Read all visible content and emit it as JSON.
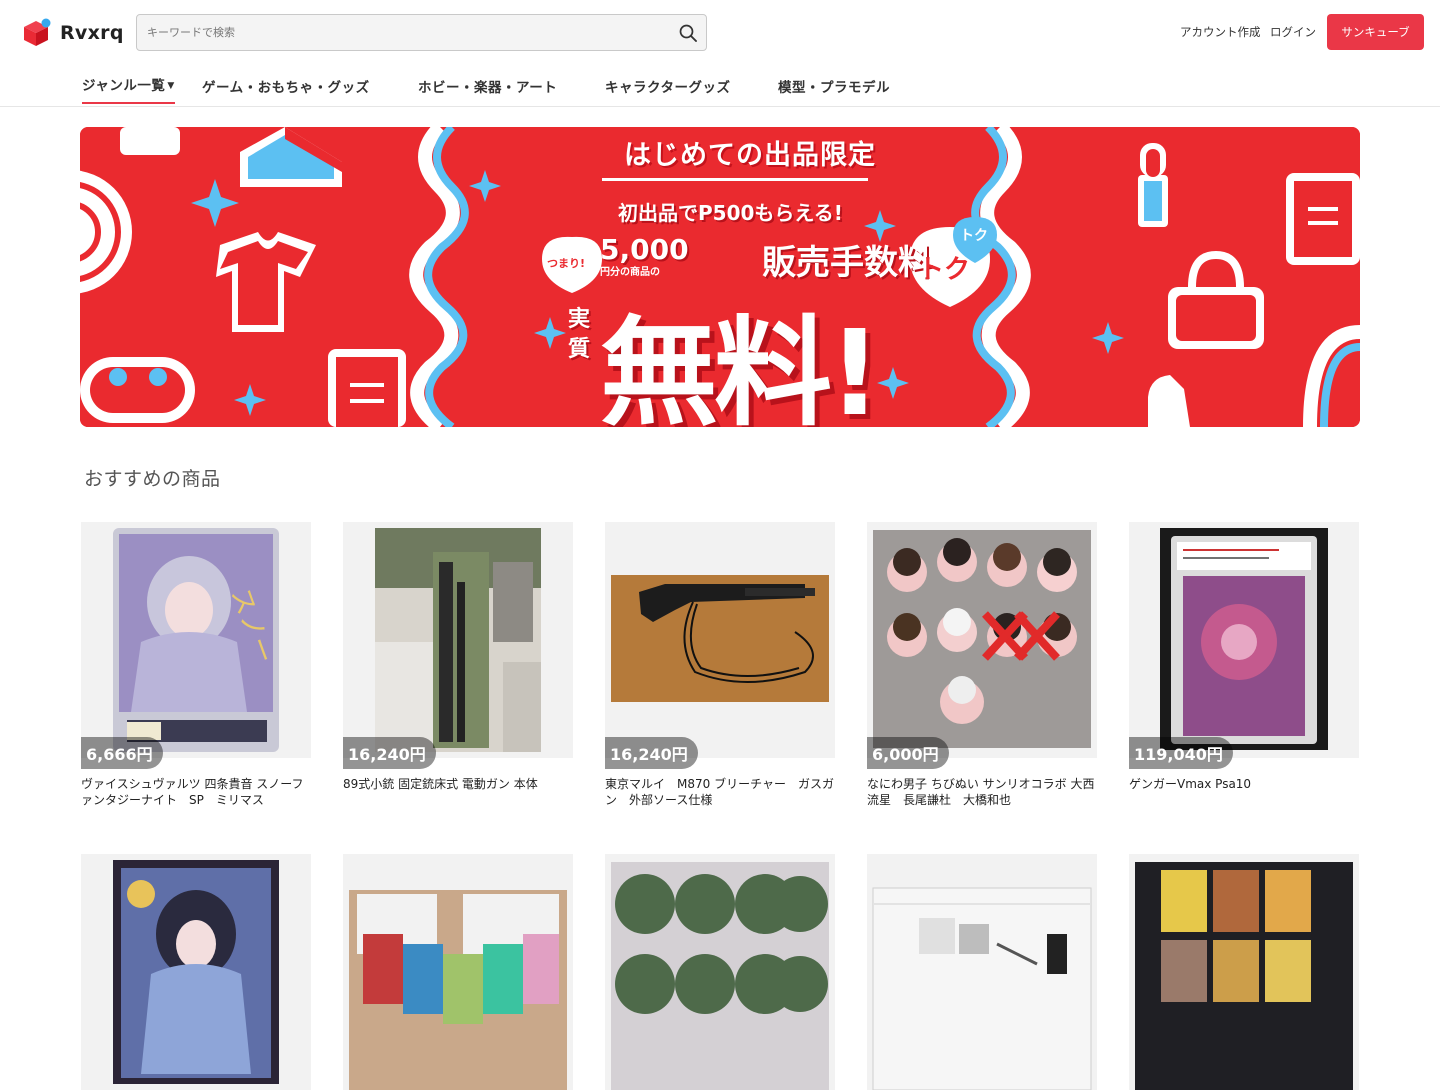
{
  "header": {
    "logo_text": "Rvxrq",
    "search_placeholder": "キーワードで検索",
    "signup_label": "アカウント作成",
    "login_label": "ログイン",
    "cta_label": "サンキューブ",
    "brand_color": "#ea3747"
  },
  "nav": {
    "items": [
      {
        "label": "ジャンル一覧"
      },
      {
        "label": "ゲーム・おもちゃ・グッズ"
      },
      {
        "label": "ホビー・楽器・アート"
      },
      {
        "label": "キャラクターグッズ"
      },
      {
        "label": "模型・プラモデル"
      }
    ]
  },
  "banner": {
    "title": "はじめての出品限定",
    "subtitle": "初出品でP500もらえる!",
    "badge_left": "つまり!",
    "amount": "5,000",
    "amount_unit": "円分の商品の",
    "fee": "販売手数料",
    "jitsu": "実質",
    "free": "無料!",
    "heart_big": "トク",
    "heart_small": "トク"
  },
  "section": {
    "title": "おすすめの商品"
  },
  "products": [
    {
      "price": "6,666円",
      "name": "ヴァイスシュヴァルツ 四条貴音 スノーファンタジーナイト　SP　ミリマス"
    },
    {
      "price": "16,240円",
      "name": "89式小銃 固定銃床式 電動ガン 本体"
    },
    {
      "price": "16,240円",
      "name": "東京マルイ　M870 ブリーチャー　ガスガン　外部ソース仕様"
    },
    {
      "price": "6,000円",
      "name": "なにわ男子 ちびぬい サンリオコラボ 大西流星　長尾謙杜　大橋和也"
    },
    {
      "price": "119,040円",
      "name": "ゲンガーVmax Psa10"
    },
    {
      "price": "",
      "name": ""
    },
    {
      "price": "",
      "name": ""
    },
    {
      "price": "",
      "name": ""
    },
    {
      "price": "",
      "name": ""
    },
    {
      "price": "",
      "name": ""
    }
  ]
}
